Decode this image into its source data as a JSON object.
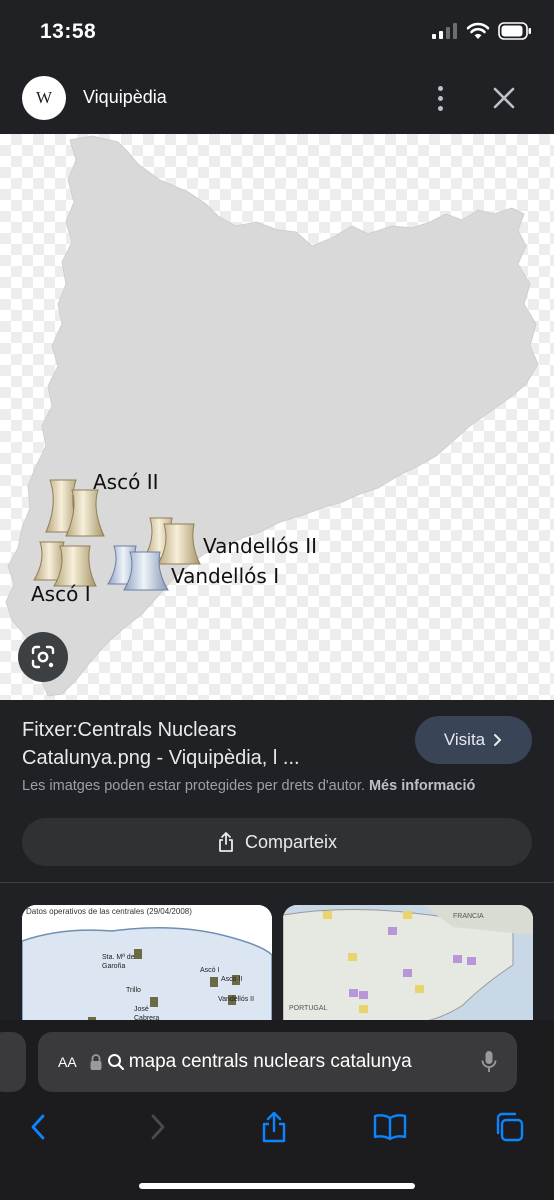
{
  "status_bar": {
    "time": "13:58"
  },
  "header": {
    "site_logo": "W",
    "site_name": "Viquipèdia"
  },
  "map": {
    "labels": [
      {
        "id": "asco-ii",
        "text": "Ascó II"
      },
      {
        "id": "vandellos-ii",
        "text": "Vandellós II"
      },
      {
        "id": "vandellos-i",
        "text": "Vandellós I"
      },
      {
        "id": "asco-i",
        "text": "Ascó I"
      }
    ]
  },
  "result": {
    "title_line1": "Fitxer:Centrals Nuclears",
    "title_line2": "Catalunya.png - Viquipèdia, l ...",
    "visit_label": "Visita",
    "copyright_text": "Les imatges poden estar protegides per drets d'autor.",
    "more_info": "Més informació",
    "share_label": "Comparteix"
  },
  "related": {
    "thumb1_title": "Datos operativos de las centrales (29/04/2008)",
    "thumb1_labels": [
      "Sta. Mª de Garoña",
      "Ascó I",
      "Ascó II",
      "Trillo",
      "Vandellós II",
      "José Cabrera"
    ],
    "thumb2_labels": [
      "FRANCIA",
      "PORTUGAL"
    ]
  },
  "browser": {
    "aa_label": "AA",
    "url": "mapa centrals nuclears catalunya"
  },
  "colors": {
    "background": "#202124",
    "visit_button": "#394457",
    "share_button": "#303134",
    "map_fill": "#d9d9d9",
    "ios_blue": "#0a84ff"
  }
}
